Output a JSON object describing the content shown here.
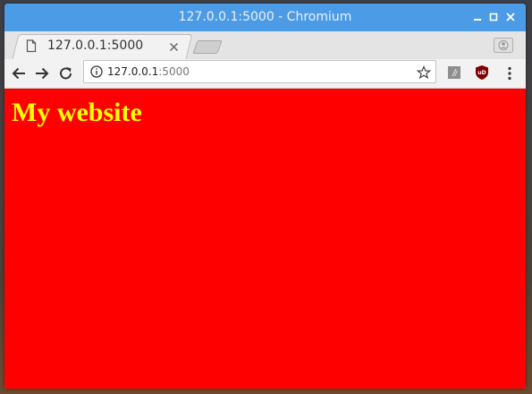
{
  "window": {
    "title": "127.0.0.1:5000 - Chromium",
    "minimize_label": "_",
    "maximize_label": "□",
    "close_label": "×"
  },
  "tab": {
    "label": "127.0.0.1:5000",
    "close_label": "×",
    "icon": "page-icon"
  },
  "toolbar": {
    "back_icon": "arrow-left-icon",
    "forward_icon": "arrow-right-icon",
    "reload_icon": "reload-icon",
    "url_host": "127.0.0.1",
    "url_path": ":5000",
    "info_icon": "info-icon",
    "bookmark_icon": "star-icon",
    "extension1_icon": "extension-icon",
    "extension2_icon": "ublock-icon",
    "ublock_label": "uD",
    "menu_icon": "kebab-menu-icon"
  },
  "page": {
    "heading": "My website",
    "background_color": "#ff0000",
    "heading_color": "#ffff00"
  },
  "colors": {
    "titlebar": "#4c9be6"
  }
}
